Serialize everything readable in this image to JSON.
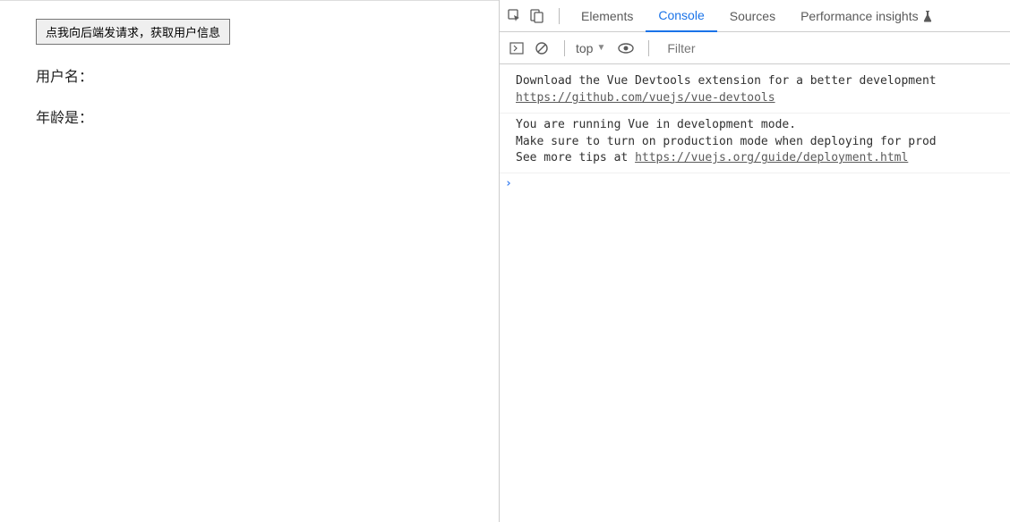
{
  "page": {
    "button_label": "点我向后端发请求，获取用户信息",
    "username_label": "用户名：",
    "age_label": "年龄是："
  },
  "devtools": {
    "tabs": {
      "elements": "Elements",
      "console": "Console",
      "sources": "Sources",
      "performance_insights": "Performance insights"
    },
    "toolbar": {
      "context": "top",
      "filter_placeholder": "Filter"
    },
    "messages": {
      "m1_line1": "Download the Vue Devtools extension for a better development",
      "m1_link": "https://github.com/vuejs/vue-devtools",
      "m2_line1": "You are running Vue in development mode.",
      "m2_line2": "Make sure to turn on production mode when deploying for prod",
      "m2_line3_prefix": "See more tips at ",
      "m2_link": "https://vuejs.org/guide/deployment.html"
    },
    "prompt": "›"
  }
}
